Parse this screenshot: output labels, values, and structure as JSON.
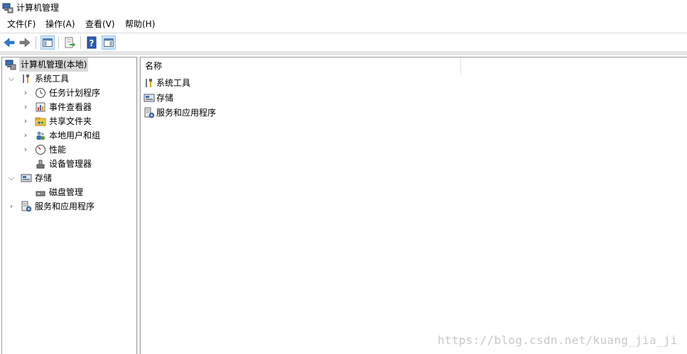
{
  "window": {
    "title": "计算机管理"
  },
  "menu": {
    "file": "文件(F)",
    "action": "操作(A)",
    "view": "查看(V)",
    "help": "帮助(H)"
  },
  "toolbar": {
    "icons": [
      "back-arrow-icon",
      "forward-arrow-icon",
      "show-hide-console-tree-icon",
      "export-list-icon",
      "help-icon",
      "show-hide-action-pane-icon"
    ]
  },
  "tree": {
    "root": "计算机管理(本地)",
    "system_tools": "系统工具",
    "task_scheduler": "任务计划程序",
    "event_viewer": "事件查看器",
    "shared_folders": "共享文件夹",
    "local_users_groups": "本地用户和组",
    "performance": "性能",
    "device_manager": "设备管理器",
    "storage": "存储",
    "disk_management": "磁盘管理",
    "services_apps": "服务和应用程序"
  },
  "list": {
    "column_name": "名称",
    "items": [
      "系统工具",
      "存储",
      "服务和应用程序"
    ]
  },
  "watermark": "https://blog.csdn.net/kuang_jia_ji"
}
